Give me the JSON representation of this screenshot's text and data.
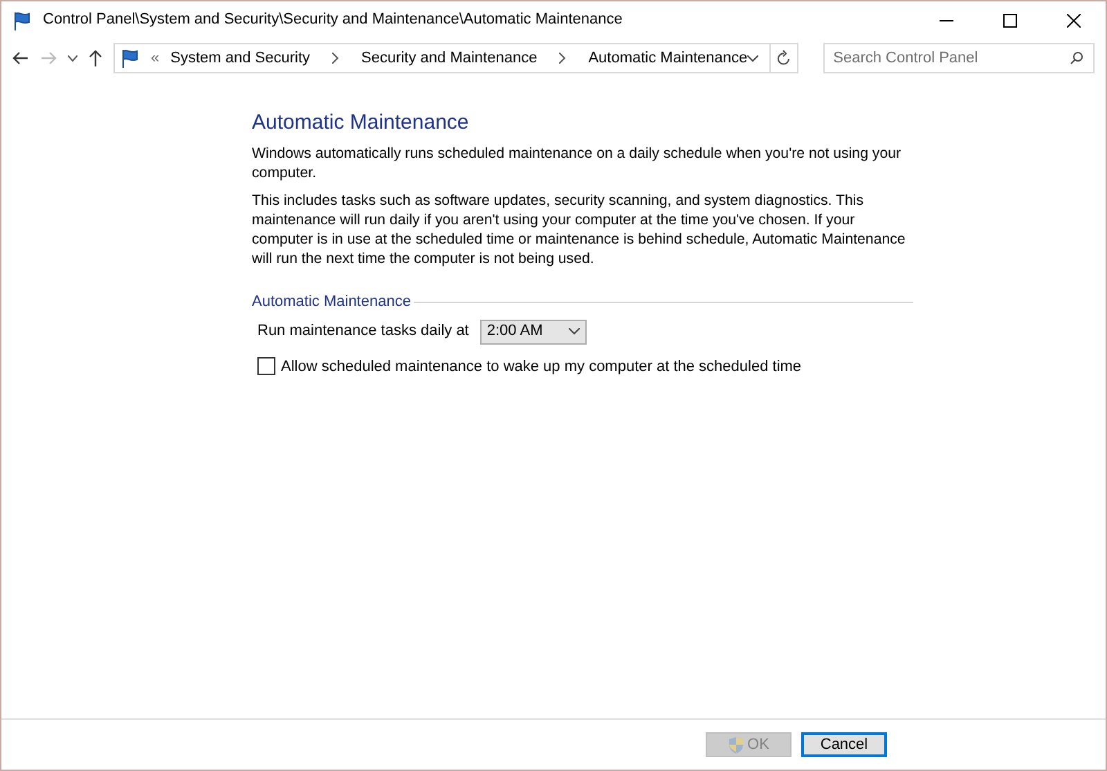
{
  "window": {
    "title": "Control Panel\\System and Security\\Security and Maintenance\\Automatic Maintenance"
  },
  "address_bar": {
    "overflow": "«",
    "breadcrumbs": [
      "System and Security",
      "Security and Maintenance",
      "Automatic Maintenance"
    ]
  },
  "search": {
    "placeholder": "Search Control Panel"
  },
  "heading": "Automatic Maintenance",
  "paragraphs": [
    "Windows automatically runs scheduled maintenance on a daily schedule when you're not using your computer.",
    "This includes tasks such as software updates, security scanning, and system diagnostics. This maintenance will run daily if you aren't using your computer at the time you've chosen. If your computer is in use at the scheduled time or maintenance is behind schedule, Automatic Maintenance will run the next time the computer is not being used."
  ],
  "section": {
    "legend": "Automatic Maintenance",
    "schedule_label": "Run maintenance tasks daily at",
    "time": "2:00 AM",
    "wake_option": {
      "label": "Allow scheduled maintenance to wake up my computer at the scheduled time",
      "checked": false
    }
  },
  "buttons": [
    {
      "label": "OK",
      "kind": "shield",
      "disabled": true
    },
    {
      "label": "Cancel",
      "kind": "plain",
      "disabled": false
    }
  ]
}
